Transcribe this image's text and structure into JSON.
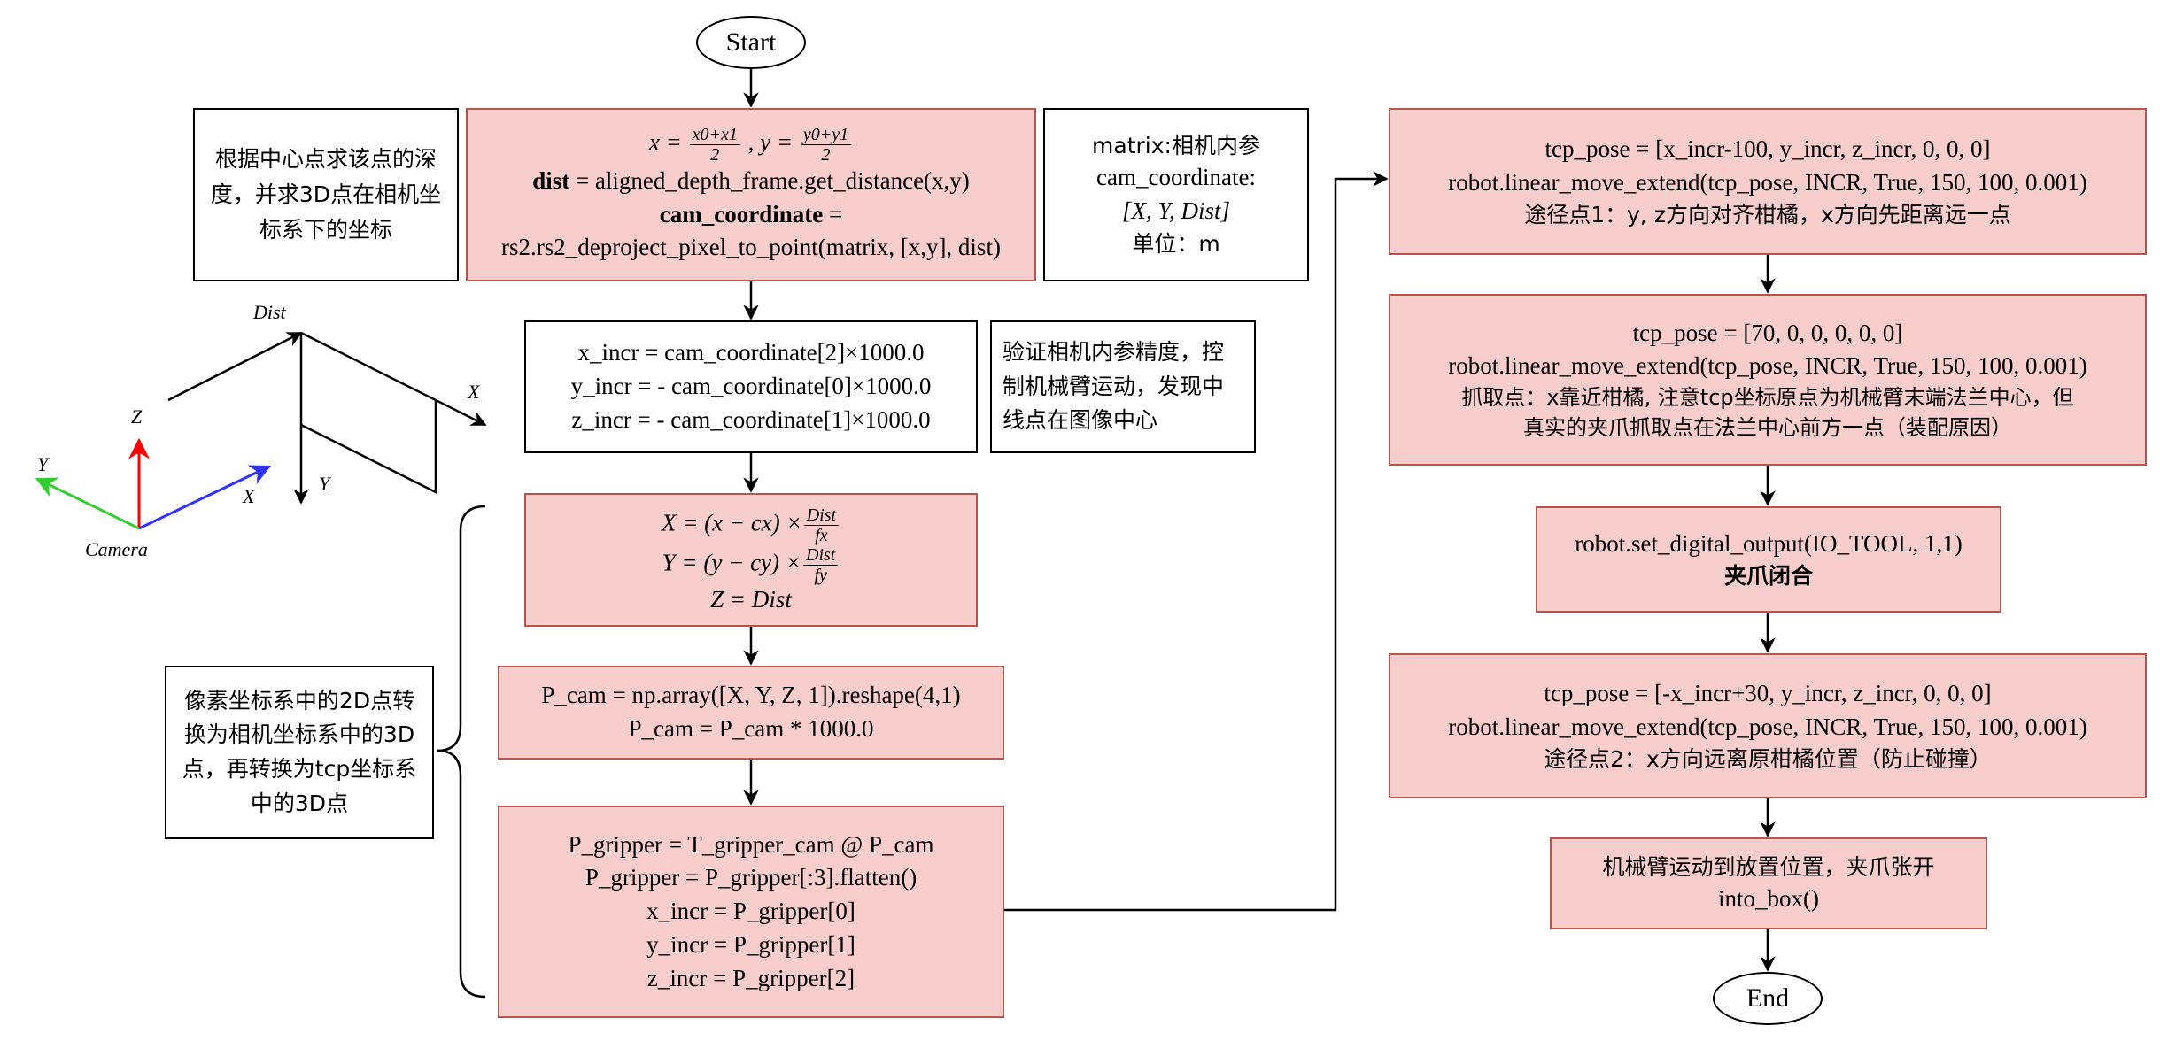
{
  "flow": {
    "start": "Start",
    "end": "End",
    "center": {
      "x_eq": "x =",
      "x_num": "x0+x1",
      "x_den": "2",
      "sep": ", y =",
      "y_num": "y0+y1",
      "y_den": "2",
      "dist_name": "dist",
      "dist_expr": " = aligned_depth_frame.get_distance(x,y)",
      "cam_name": "cam_coordinate",
      "cam_eq": " =",
      "cam_expr": "rs2.rs2_deproject_pixel_to_point(matrix, [x,y], dist)"
    },
    "incr": {
      "l1": "x_incr = cam_coordinate[2]×1000.0",
      "l2": "y_incr = - cam_coordinate[0]×1000.0",
      "l3": "z_incr = - cam_coordinate[1]×1000.0"
    },
    "formula": {
      "x_lhs": "X = (x − cx) ×",
      "y_lhs": "Y = (y − cy) ×",
      "num": "Dist",
      "fx": "fx",
      "fy": "fy",
      "z": "Z = Dist"
    },
    "pcam": {
      "l1": "P_cam = np.array([X, Y, Z, 1]).reshape(4,1)",
      "l2": "P_cam = P_cam * 1000.0"
    },
    "gripper": {
      "l1": "P_gripper = T_gripper_cam @ P_cam",
      "l2": "P_gripper = P_gripper[:3].flatten()",
      "l3": "x_incr = P_gripper[0]",
      "l4": "y_incr = P_gripper[1]",
      "l5": "z_incr = P_gripper[2]"
    },
    "tcp1": {
      "l1": "tcp_pose = [x_incr-100, y_incr, z_incr, 0, 0, 0]",
      "l2": "robot.linear_move_extend(tcp_pose, INCR, True, 150, 100, 0.001)",
      "l3": "途径点1：y, z方向对齐柑橘，x方向先距离远一点"
    },
    "tcp2": {
      "l1": "tcp_pose = [70, 0, 0, 0, 0, 0]",
      "l2": "robot.linear_move_extend(tcp_pose, INCR, True, 150, 100, 0.001)",
      "l3": "抓取点：x靠近柑橘, 注意tcp坐标原点为机械臂末端法兰中心，但",
      "l4": "真实的夹爪抓取点在法兰中心前方一点（装配原因）"
    },
    "io": {
      "l1": "robot.set_digital_output(IO_TOOL, 1,1)",
      "l2": "夹爪闭合"
    },
    "tcp3": {
      "l1": "tcp_pose = [-x_incr+30, y_incr, z_incr, 0, 0, 0]",
      "l2": "robot.linear_move_extend(tcp_pose, INCR, True, 150, 100, 0.001)",
      "l3": "途径点2：x方向远离原柑橘位置（防止碰撞）"
    },
    "place": {
      "l1": "机械臂运动到放置位置，夹爪张开",
      "l2": "into_box()"
    }
  },
  "notes": {
    "depth": "根据中心点求该点的深度，并求3D点在相机坐标系下的坐标",
    "matrix_l1": "matrix:相机内参",
    "matrix_l2": "cam_coordinate:",
    "matrix_l3": "[X, Y, Dist]",
    "matrix_l4": "单位：m",
    "verify": "验证相机内参精度，控制机械臂运动，发现中线点在图像中心",
    "pixel": "像素坐标系中的2D点转换为相机坐标系中的3D点，再转换为tcp坐标系中的3D点"
  },
  "axes": {
    "camera": "Camera",
    "x": "X",
    "y": "Y",
    "z": "Z",
    "dist": "Dist",
    "img_x": "X",
    "img_y": "Y"
  },
  "colors": {
    "box_fill": "#f8cecc",
    "box_stroke": "#b85450",
    "axis_x": "#3333ff",
    "axis_y": "#33cc33",
    "axis_z": "#ff0000"
  }
}
